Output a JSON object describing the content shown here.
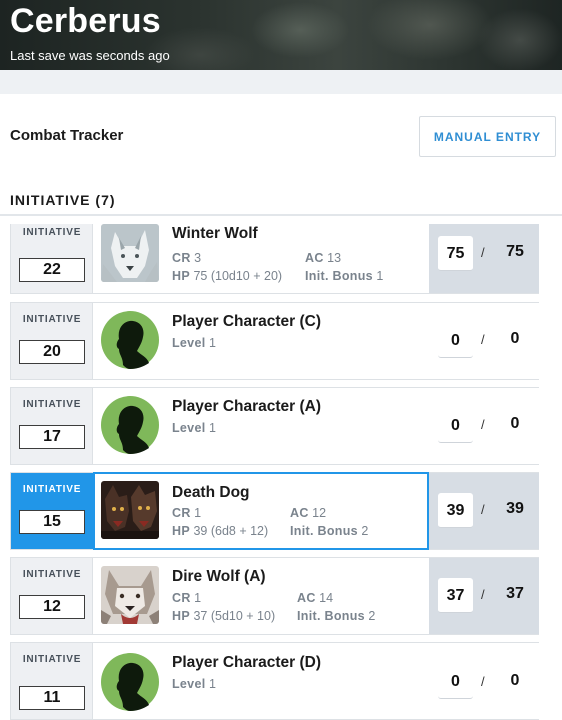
{
  "header": {
    "title": "Cerberus",
    "subtitle": "Last save was seconds ago"
  },
  "toolbar": {
    "title": "Combat Tracker",
    "manual_entry_label": "MANUAL ENTRY"
  },
  "initiative": {
    "heading": "INITIATIVE (7)",
    "label": "INITIATIVE",
    "stat_labels": {
      "cr": "CR",
      "ac": "AC",
      "hp": "HP",
      "init_bonus": "Init. Bonus",
      "level": "Level"
    },
    "combatants": [
      {
        "name": "Winter Wolf",
        "initiative": "22",
        "cr": "3",
        "ac": "13",
        "hp": "75 (10d10 + 20)",
        "init_bonus": "1",
        "hp_current": "75",
        "hp_max": "75",
        "portrait_icon": "winter-wolf-portrait"
      },
      {
        "name": "Player Character (C)",
        "initiative": "20",
        "level": "1",
        "hp_current": "0",
        "hp_max": "0",
        "portrait_icon": "player-silhouette-icon"
      },
      {
        "name": "Player Character (A)",
        "initiative": "17",
        "level": "1",
        "hp_current": "0",
        "hp_max": "0",
        "portrait_icon": "player-silhouette-icon"
      },
      {
        "name": "Death Dog",
        "initiative": "15",
        "cr": "1",
        "ac": "12",
        "hp": "39 (6d8 + 12)",
        "init_bonus": "2",
        "hp_current": "39",
        "hp_max": "39",
        "portrait_icon": "death-dog-portrait"
      },
      {
        "name": "Dire Wolf (A)",
        "initiative": "12",
        "cr": "1",
        "ac": "14",
        "hp": "37 (5d10 + 10)",
        "init_bonus": "2",
        "hp_current": "37",
        "hp_max": "37",
        "portrait_icon": "dire-wolf-portrait"
      },
      {
        "name": "Player Character (D)",
        "initiative": "11",
        "level": "1",
        "hp_current": "0",
        "hp_max": "0",
        "portrait_icon": "player-silhouette-icon"
      }
    ]
  },
  "colors": {
    "accent": "#2196e8",
    "button_text": "#2f8ed3",
    "silhouette_bg": "#7fb85a",
    "monster_hp_bg": "#d7dde4"
  },
  "hp_separator": "/"
}
